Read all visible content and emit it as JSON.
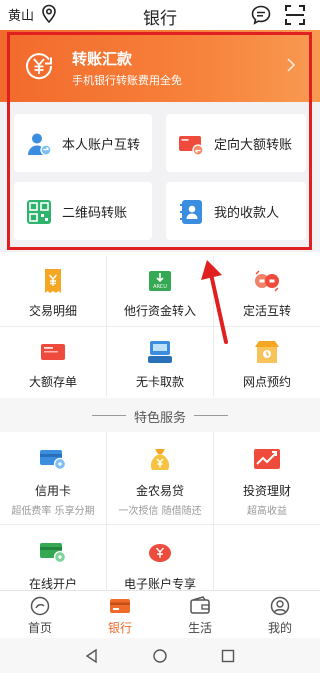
{
  "header": {
    "location": "黄山",
    "title": "银行",
    "icons": [
      "location-pin-icon",
      "message-icon",
      "scan-icon"
    ]
  },
  "transfer_banner": {
    "title": "转账汇款",
    "subtitle": "手机银行转账费用全免"
  },
  "transfer_cards": [
    {
      "label": "本人账户互转",
      "icon": "user-transfer-icon"
    },
    {
      "label": "定向大额转账",
      "icon": "large-transfer-card-icon"
    },
    {
      "label": "二维码转账",
      "icon": "qr-code-icon"
    },
    {
      "label": "我的收款人",
      "icon": "payee-book-icon"
    }
  ],
  "quick_grid": [
    {
      "label": "交易明细",
      "icon": "receipt-yen-icon"
    },
    {
      "label": "他行资金转入",
      "icon": "arcu-inbound-icon"
    },
    {
      "label": "定活互转",
      "icon": "fixed-current-swap-icon"
    },
    {
      "label": "大额存单",
      "icon": "deposit-certificate-icon"
    },
    {
      "label": "无卡取款",
      "icon": "cardless-atm-icon"
    },
    {
      "label": "网点预约",
      "icon": "branch-store-icon"
    }
  ],
  "featured_section": {
    "title": "特色服务"
  },
  "featured_grid": [
    {
      "label": "信用卡",
      "sub": "超低费率 乐享分期",
      "icon": "credit-card-icon"
    },
    {
      "label": "金农易贷",
      "sub": "一次授信 随借随还",
      "icon": "loan-bag-icon"
    },
    {
      "label": "投资理财",
      "sub": "超高收益",
      "icon": "investment-chart-icon"
    },
    {
      "label": "在线开户",
      "sub": "",
      "icon": "online-account-icon"
    },
    {
      "label": "电子账户专享",
      "sub": "",
      "icon": "piggy-bank-icon"
    }
  ],
  "tabs": [
    {
      "label": "首页",
      "icon": "home-icon",
      "active": false
    },
    {
      "label": "银行",
      "icon": "bank-card-icon",
      "active": true
    },
    {
      "label": "生活",
      "icon": "wallet-icon",
      "active": false
    },
    {
      "label": "我的",
      "icon": "profile-icon",
      "active": false
    }
  ],
  "colors": {
    "accent": "#f06a2a",
    "highlight_frame": "#e02020",
    "annotation_arrow": "#e02020"
  }
}
